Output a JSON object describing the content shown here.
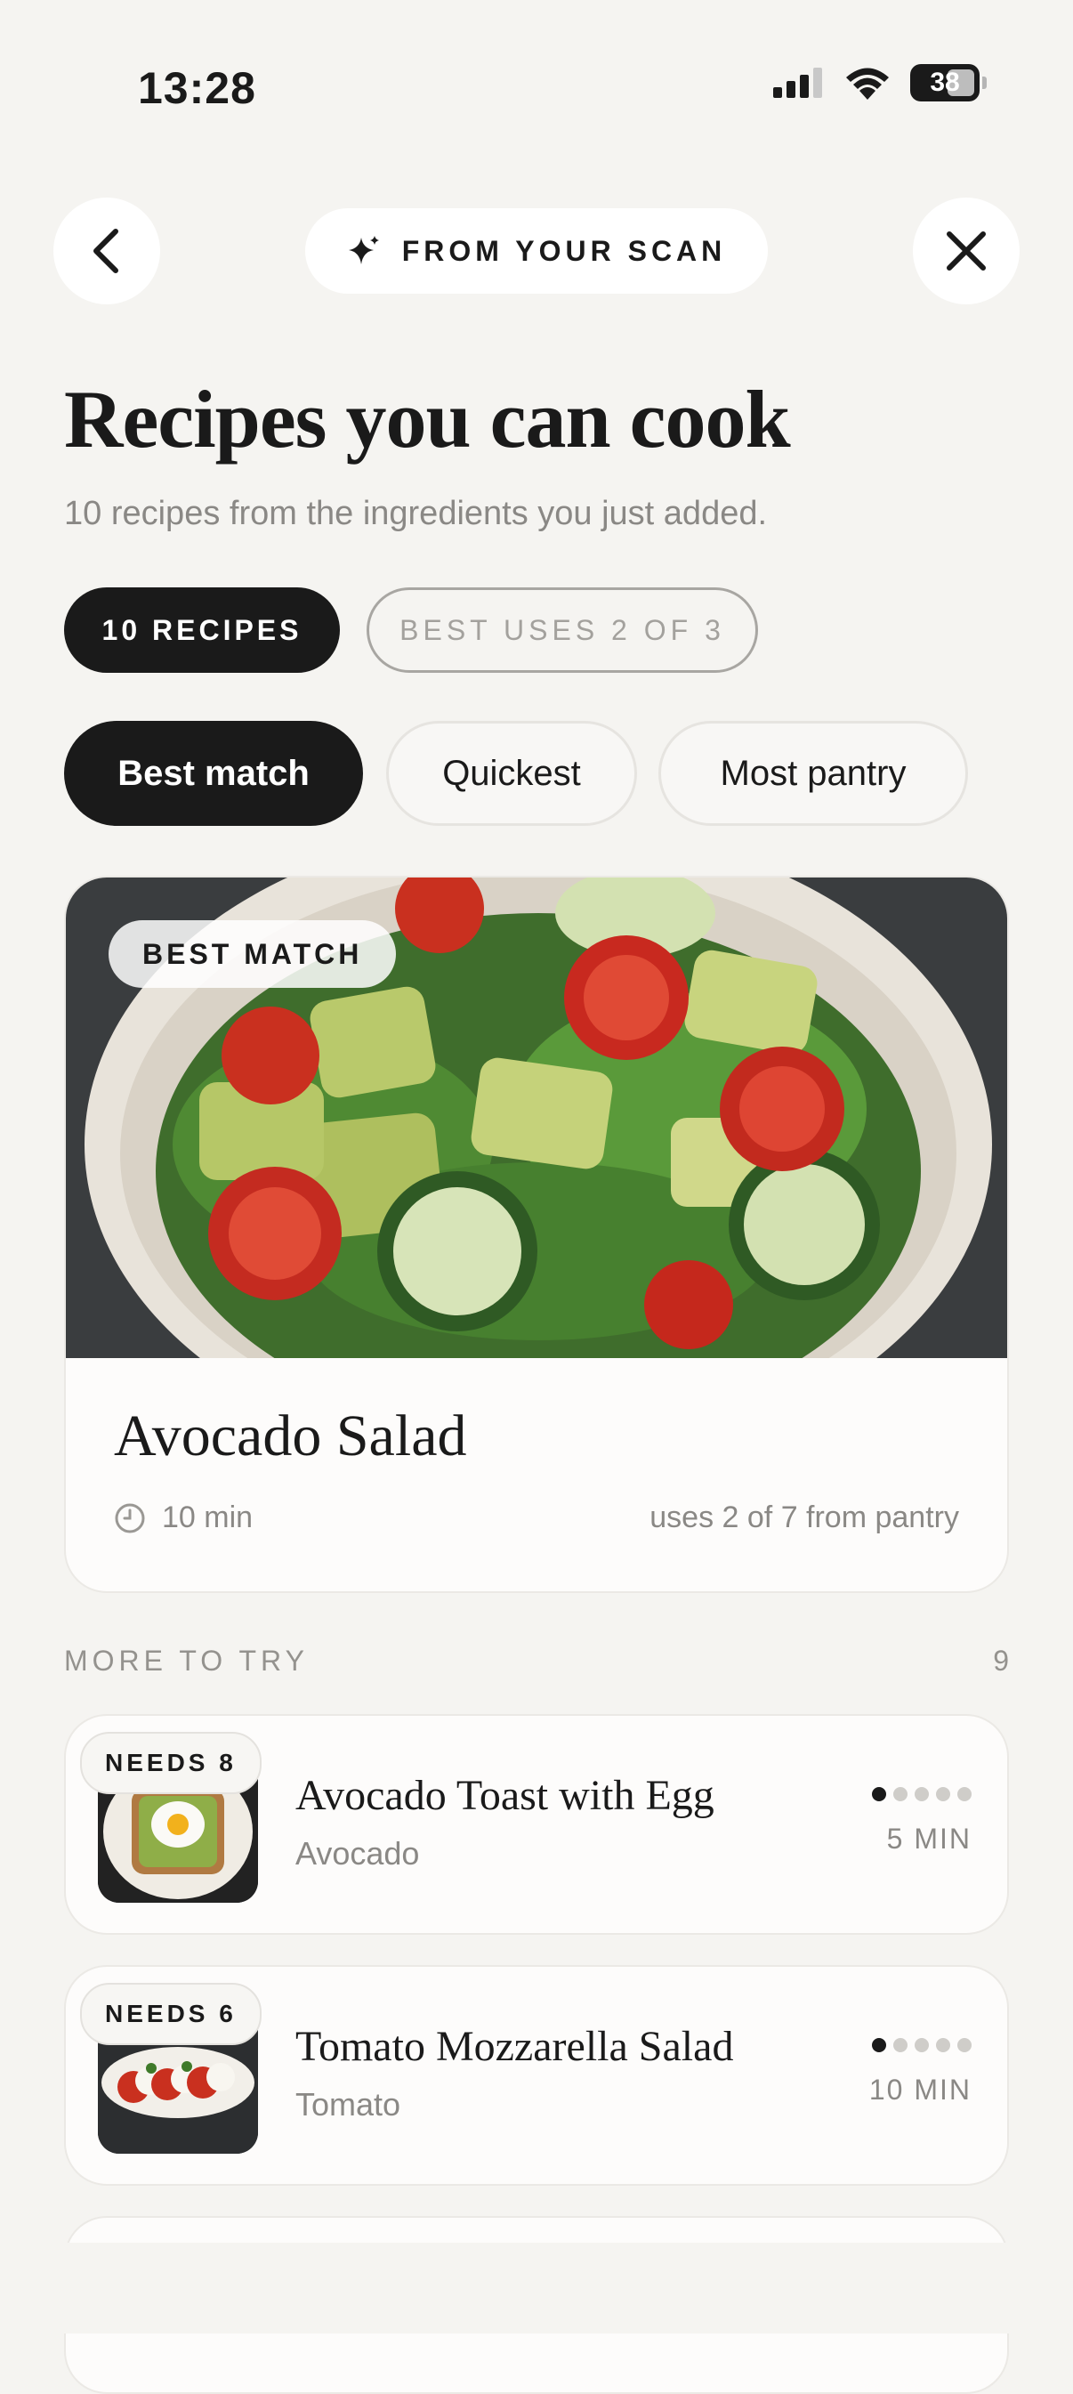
{
  "status": {
    "time": "13:28",
    "battery": "38"
  },
  "header": {
    "back_icon": "chevron-left-icon",
    "scan_label": "FROM YOUR SCAN",
    "close_icon": "close-icon"
  },
  "page": {
    "title": "Recipes you can cook",
    "subtitle": "10 recipes from the ingredients you just added."
  },
  "badges": {
    "count": "10 RECIPES",
    "uses": "BEST USES 2 OF 3"
  },
  "sort_tabs": [
    {
      "label": "Best match",
      "active": true
    },
    {
      "label": "Quickest",
      "active": false
    },
    {
      "label": "Most pantry",
      "active": false
    }
  ],
  "featured": {
    "tag": "BEST MATCH",
    "name": "Avocado Salad",
    "time": "10 min",
    "pantry": "uses 2 of 7 from pantry"
  },
  "more": {
    "label": "MORE TO TRY",
    "count": "9",
    "items": [
      {
        "needs": "NEEDS 8",
        "name": "Avocado Toast with Egg",
        "ingredient": "Avocado",
        "time": "5 MIN",
        "difficulty": 1
      },
      {
        "needs": "NEEDS 6",
        "name": "Tomato Mozzarella Salad",
        "ingredient": "Tomato",
        "time": "10 MIN",
        "difficulty": 1
      }
    ]
  }
}
